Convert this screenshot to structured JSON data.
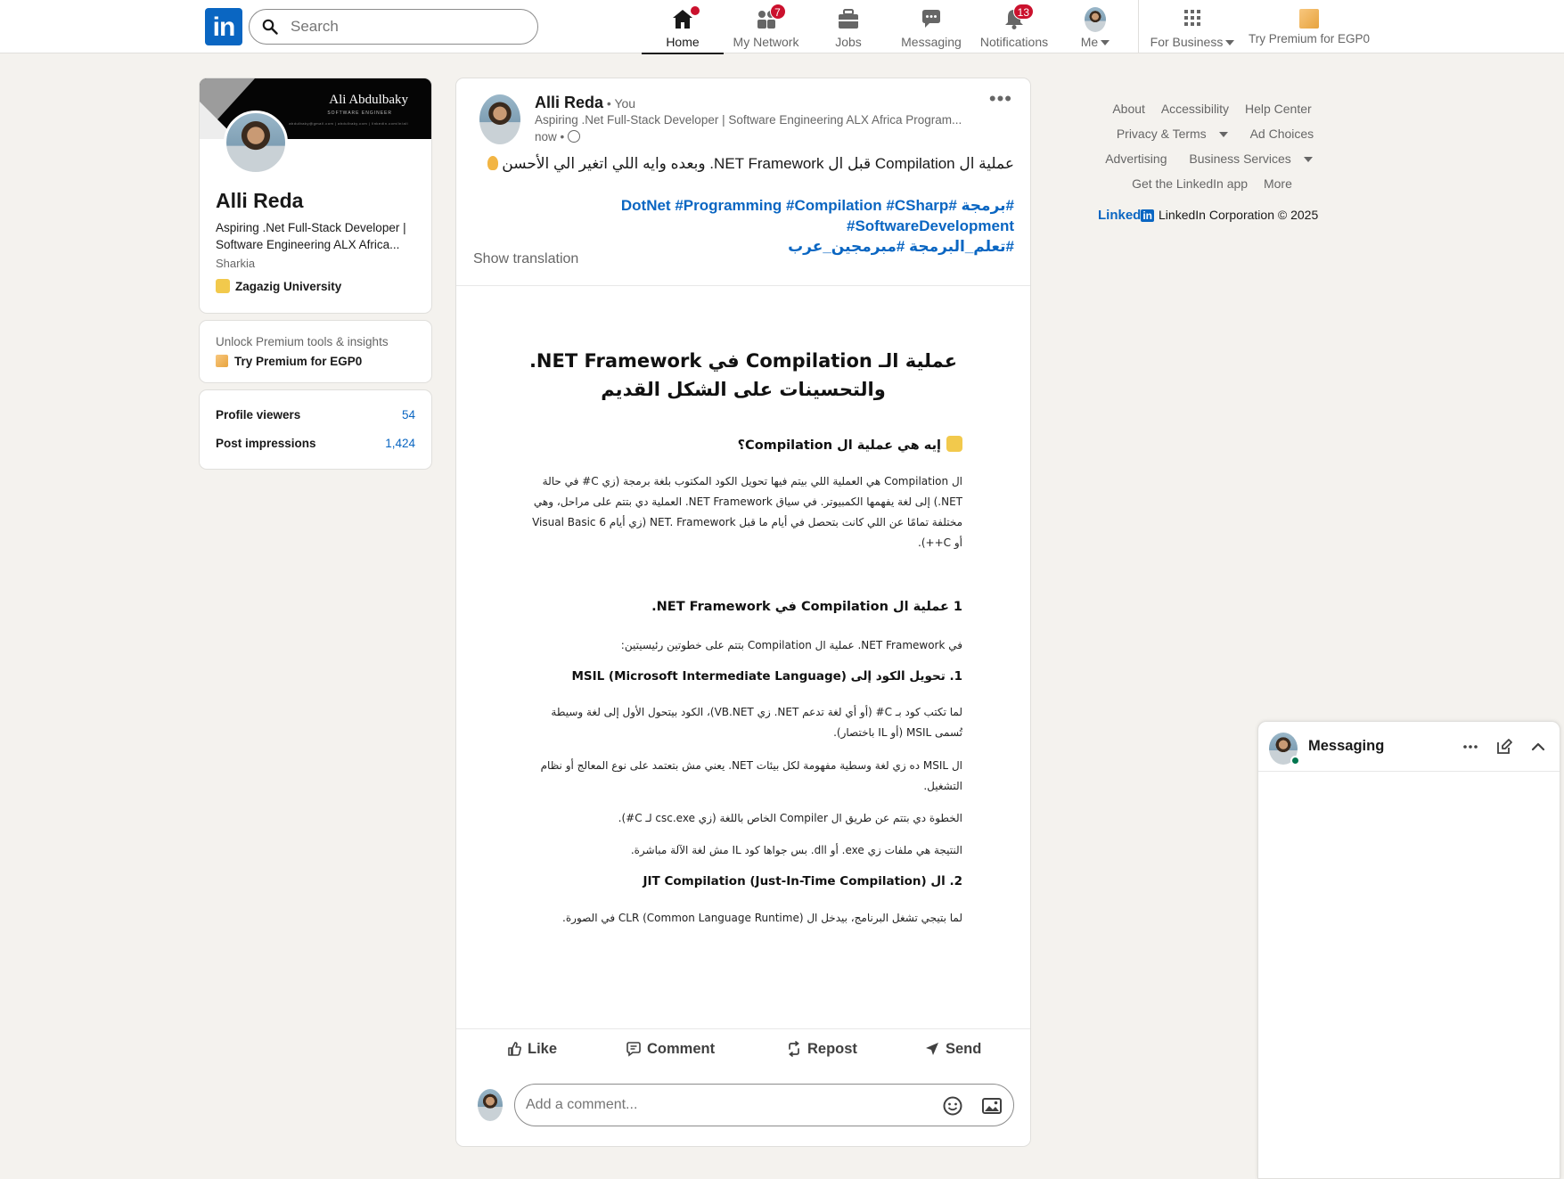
{
  "nav": {
    "logo_text": "in",
    "search_placeholder": "Search",
    "items": [
      {
        "label": "Home",
        "badge": ""
      },
      {
        "label": "My Network",
        "badge": "7"
      },
      {
        "label": "Jobs",
        "badge": ""
      },
      {
        "label": "Messaging",
        "badge": ""
      },
      {
        "label": "Notifications",
        "badge": "13"
      },
      {
        "label": "Me",
        "badge": ""
      },
      {
        "label": "For Business",
        "badge": ""
      },
      {
        "label": "Try Premium for EGP0",
        "badge": ""
      }
    ],
    "brand_color": "#0a66c2",
    "badge_color": "#cb112d"
  },
  "profile": {
    "banner_name": "Ali Abdulbaky",
    "banner_sub": "SOFTWARE ENGINEER",
    "banner_contact": "abdulbaky@gmail.com | abdulbaky.com | linkedin.com/in/ali",
    "name": "Alli Reda",
    "headline": "Aspiring .Net Full-Stack Developer | Software Engineering ALX Africa...",
    "location": "Sharkia",
    "school": "Zagazig University"
  },
  "premium": {
    "line1": "Unlock Premium tools & insights",
    "line2": "Try Premium for EGP0"
  },
  "stats": [
    {
      "label": "Profile viewers",
      "value": "54"
    },
    {
      "label": "Post impressions",
      "value": "1,424"
    }
  ],
  "post": {
    "author": "Alli Reda",
    "you": " • You",
    "headline": "Aspiring .Net Full-Stack Developer | Software Engineering ALX Africa Program...",
    "time": "now •",
    "text": "عملية ال Compilation قبل ال NET Framework. وبعده وايه اللي اتغير الي الأحسن",
    "tags_line1": "#برمجة #DotNet #Programming #Compilation #CSharp #SoftwareDevelopment",
    "tags_line2": "#تعلم_البرمجة #مبرمجين_عرب",
    "show_translation": "Show translation",
    "doc": {
      "title_line1": "عملية الـ Compilation في NET Framework.",
      "title_line2": "والتحسينات على الشكل القديم",
      "h1": "إيه هي عملية ال Compilation؟",
      "p1": "ال Compilation هي العملية اللي بيتم فيها تحويل الكود المكتوب بلغة برمجة (زي C# في حالة NET.) إلى لغة يفهمها الكمبيوتر. في سياق NET Framework. العملية دي بتتم على مراحل، وهي مختلفة تمامًا عن اللي كانت بتحصل في أيام ما قبل NET. Framework (زي أيام Visual Basic 6 أو C++).",
      "h2": "1 عملية ال Compilation في NET Framework.",
      "p2": "في NET Framework. عملية ال Compilation بتتم على خطوتين رئيسيتين:",
      "h3": "1. تحويل الكود إلى MSIL (Microsoft Intermediate Language)",
      "p3": "لما تكتب كود بـ C# (أو أي لغة تدعم NET. زي VB.NET)، الكود بيتحول الأول إلى لغة وسيطة تُسمى MSIL (أو IL باختصار).",
      "p4": "ال MSIL ده زي لغة وسطية مفهومة لكل بيئات NET. يعني مش بتعتمد على نوع المعالج أو نظام التشغيل.",
      "p5": "الخطوة دي بتتم عن طريق ال Compiler الخاص باللغة (زي csc.exe لـ C#).",
      "p6": "النتيجة هي ملفات زي exe. أو dll. بس جواها كود IL مش لغة الآلة مباشرة.",
      "h4": "2. ال JIT Compilation (Just-In-Time Compilation)",
      "p7": "لما بتيجي تشغل البرنامج، بيدخل ال CLR (Common Language Runtime) في الصورة."
    },
    "actions": {
      "like": "Like",
      "comment": "Comment",
      "repost": "Repost",
      "send": "Send"
    },
    "comment_placeholder": "Add a comment..."
  },
  "footer": {
    "links": [
      "About",
      "Accessibility",
      "Help Center",
      "Privacy & Terms",
      "Ad Choices",
      "Advertising",
      "Business Services",
      "Get the LinkedIn app",
      "More"
    ],
    "brand_word": "Linked",
    "brand_box": "in",
    "copyright": "LinkedIn Corporation © 2025"
  },
  "messaging": {
    "title": "Messaging"
  }
}
